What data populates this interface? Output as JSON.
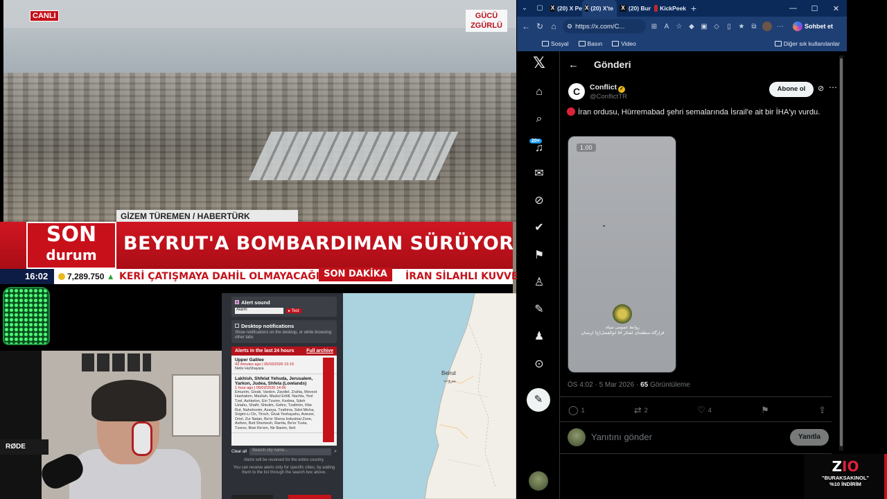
{
  "tv": {
    "live_badge": "CANLI",
    "channel_logo": "GÜCÜ ZGÜRLÜ",
    "reporter": "GİZEM TÜREMEN / HABERTÜRK",
    "son_top": "SON",
    "son_bottom": "durum",
    "headline": "BEYRUT'A BOMBARDIMAN SÜRÜYOR MU?",
    "time": "16:02",
    "bist_value": "7,289.750",
    "ticker_left": "KERİ ÇATIŞMAYA DAHİL OLMAYACAĞIZ",
    "ticker_badge": "SON DAKİKA",
    "ticker_right": "İRAN SİLAHLI KUVVETL"
  },
  "stream": {
    "mic_brand": "RØDE"
  },
  "alerts": {
    "alert_sound_label": "Alert sound",
    "alert_sound_value": "Alarm",
    "test_label": "▸ Test",
    "desktop_label": "Desktop notifications",
    "desktop_desc": "Show notifications on the desktop, or while browsing other tabs",
    "last24_label": "Alerts in the last 24 hours",
    "archive_label": "Full archive",
    "items": [
      {
        "name": "Upper Galilee",
        "time": "43 minutes ago | 05/03/2026 15:19",
        "desc": "Netiv HaShayara"
      },
      {
        "name": "Lakhish, Shfelat Yehuda, Jerusalem, Yarkon, Judea, Shfela (Lowlands)",
        "time": "1 hour ago | 05/03/2026 14:56",
        "desc": "Emunim, Givati, Vardon, Zavdiel, Zrahia, Mevoot Hashalom, Mazliah, Maslul Ertilli, Nachla, Yevl Tzel, Ashkelon, Ein Tzurim, Kedma, Sdeh Uziahu, Shafir, Shtulim, Gefen, Tzafririm, Kfar Rut, Nahshonim, Azarya, Tzafrirra, Sdot Micha, Srigim-Li On, Tiroch, Givat Yeshayahu, Aviezer, Oriel, Zur Natan, Be'er Sheva Industrial Zone, Avihen, Beit Shemesh, Ramla, Be'er Tuvia, Tzorev, Bnei Re'em, Nir Banim, Ibrit"
      }
    ],
    "clear_all": "Clear all",
    "search_placeholder": "Search city name...",
    "footer_1": "Alerts will be received for the entire country.",
    "footer_2": "You can receive alerts only for specific cities, by adding them to the list through the search box above."
  },
  "map": {
    "city": "Beirut",
    "city_ar": "بيروت"
  },
  "browser": {
    "tabs": [
      {
        "label": "(20) X Pe",
        "icon": "x-favicon"
      },
      {
        "label": "(20) X'te",
        "icon": "x-favicon",
        "active": true
      },
      {
        "label": "(20) Bur",
        "icon": "x-favicon"
      },
      {
        "label": "KickPeek",
        "icon": "kick-favicon"
      }
    ],
    "url": "https://x.com/C...",
    "chat_label": "Sohbet et",
    "bookmarks": [
      "Sosyal",
      "Basın",
      "Video"
    ],
    "other_bookmarks": "Diğer sık kullanılanlar"
  },
  "x": {
    "notif_count": "20+",
    "header_title": "Gönderi",
    "author_name": "Conflict",
    "author_handle": "@ConflictTR",
    "subscribe_label": "Abone ol",
    "post_text": "İran ordusu, Hürremabad şehri semalarında İsrail'e ait bir İHA'yı vurdu.",
    "video_duration": "1.00",
    "video_caption_1": "روابط عمومی سپاه",
    "video_caption_2": "قرارگاه منطقه‌ای لشکر ۵۷ ابوالفضل(ع) لرستان",
    "post_meta": "ÖS 4:02 · 5 Mar 2026 · ",
    "views_count": "65",
    "views_label": " Görüntüleme",
    "replies": "1",
    "reposts": "2",
    "likes": "4",
    "reply_placeholder": "Yanıtını gönder",
    "reply_button": "Yanıtla"
  },
  "promo": {
    "brand": "Z",
    "brand_accent": "IO",
    "code": "\"BURAKSAKINOL\"",
    "discount": "%10 İNDİRİM"
  }
}
